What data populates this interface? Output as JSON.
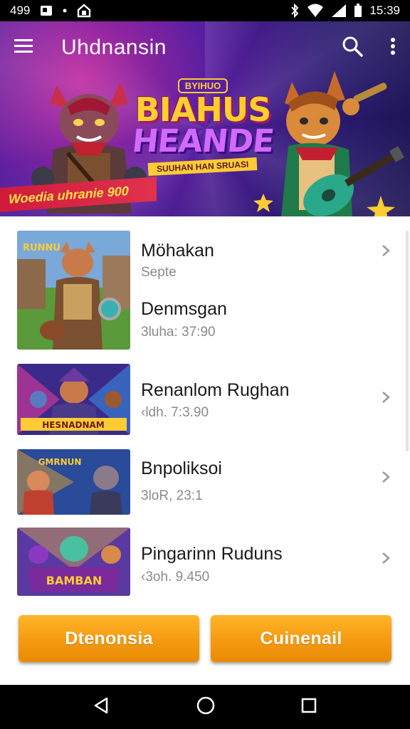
{
  "status_bar": {
    "time_left": "499",
    "time_right": "15:39",
    "icons": [
      "gallery-icon",
      "notification-dot-icon",
      "lock-icon",
      "bluetooth-icon",
      "wifi-icon",
      "signal-icon",
      "battery-icon"
    ]
  },
  "app_bar": {
    "title": "Uhdnansin",
    "menu_icon": "hamburger-menu-icon",
    "search_icon": "search-icon",
    "more_icon": "more-vert-icon"
  },
  "hero": {
    "logo_small": "BYIHUO",
    "logo_line1": "BIAHUS",
    "logo_line2": "HEANDE",
    "logo_ribbon": "SUUHAN HAN SRUASI",
    "banner_text": "Woedia uhranie 900",
    "colors": {
      "bg_top": "#5a1fa0",
      "bg_pink": "#c02aa0",
      "banner": "#d01b3a",
      "logo_gold": "#ffcf30"
    }
  },
  "list": {
    "items": [
      {
        "title": "Möhakan",
        "subtitle": "Septe",
        "title2": "Denmsgan",
        "subtitle2": "3luha: 37:90",
        "thumb_caption": "RUNNU"
      },
      {
        "title": "Renanlom Rughan",
        "subtitle": "‹ldh. 7:3.90",
        "thumb_caption": "HESNADNAM"
      },
      {
        "title": "Bnpoliksoi",
        "subtitle": "3loR, 23:1",
        "thumb_caption": "GMRNUN"
      },
      {
        "title": "Pingarinn Ruduns",
        "subtitle": "‹3oh. 9.450",
        "thumb_caption": "BAMBAN"
      }
    ]
  },
  "buttons": {
    "left_label": "Dtenonsia",
    "right_label": "Cuinenail",
    "color": "#f49a10"
  },
  "nav_bar": {
    "back_icon": "back-triangle-icon",
    "home_icon": "home-circle-icon",
    "recents_icon": "recents-square-icon"
  }
}
